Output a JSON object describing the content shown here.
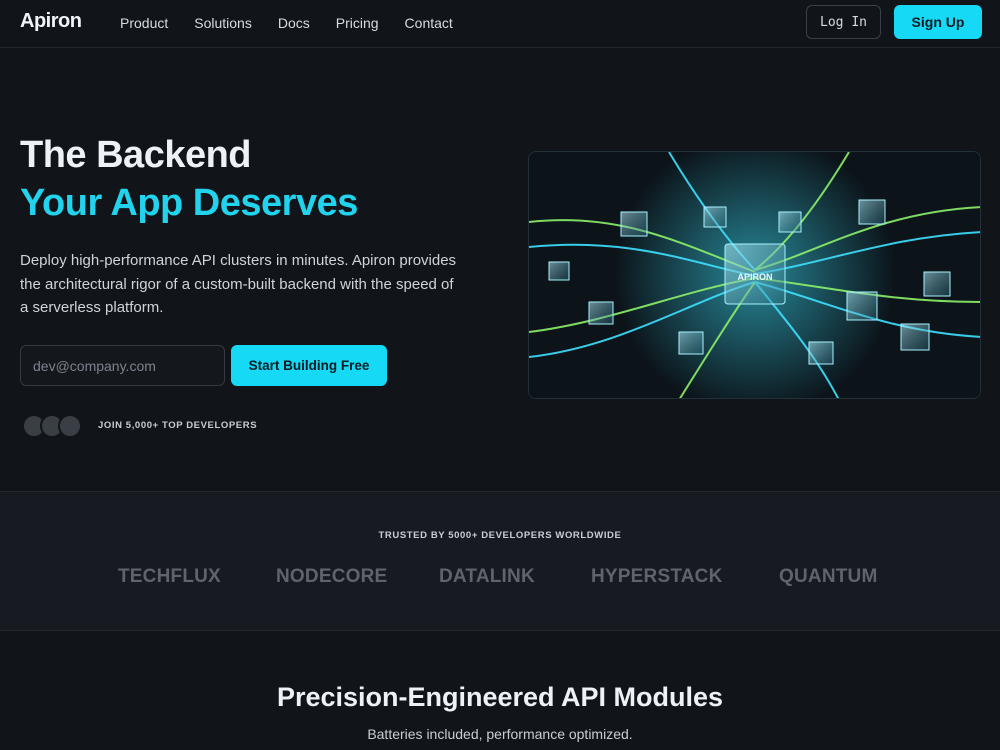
{
  "brand": {
    "name": "Apiron"
  },
  "nav": {
    "links": [
      "Product",
      "Solutions",
      "Docs",
      "Pricing",
      "Contact"
    ],
    "login_label": "Log In",
    "signup_label": "Sign Up"
  },
  "hero": {
    "title_line1": "The Backend",
    "title_line2": "Your App Deserves",
    "description": "Deploy high-performance API clusters in minutes. Apiron provides the architectural rigor of a custom-built backend with the speed of a serverless platform.",
    "email_placeholder": "dev@company.com",
    "cta_label": "Start Building Free",
    "social_proof": "JOIN 5,000+ TOP DEVELOPERS",
    "image_logo_text": "APIRON"
  },
  "trusted": {
    "title": "TRUSTED BY 5000+ DEVELOPERS WORLDWIDE",
    "brands": [
      "TECHFLUX",
      "NODECORE",
      "DATALINK",
      "HYPERSTACK",
      "QUANTUM"
    ]
  },
  "modules": {
    "title": "Precision-Engineered API Modules",
    "subtitle": "Batteries included, performance optimized."
  },
  "colors": {
    "accent": "#16d9f5",
    "accent_text": "#22d3ee",
    "background": "#111418",
    "band": "#171b21"
  }
}
